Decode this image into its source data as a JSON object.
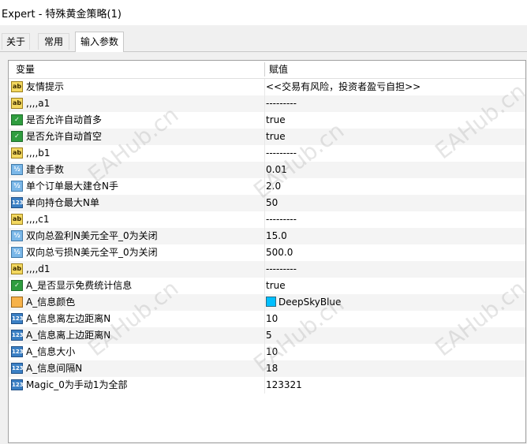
{
  "window": {
    "title": "Expert - 特殊黄金策略(1)"
  },
  "tabs": [
    {
      "label": "关于"
    },
    {
      "label": "常用"
    },
    {
      "label": "输入参数"
    }
  ],
  "grid": {
    "headers": {
      "variable": "变量",
      "value": "赋值"
    },
    "rows": [
      {
        "icon": "ab",
        "name": "友情提示",
        "value": "<<交易有风险，投资者盈亏自担>>"
      },
      {
        "icon": "ab",
        "name": ",,,,a1",
        "value": "---------"
      },
      {
        "icon": "bool",
        "name": "是否允许自动首多",
        "value": "true"
      },
      {
        "icon": "bool",
        "name": "是否允许自动首空",
        "value": "true"
      },
      {
        "icon": "ab",
        "name": ",,,,b1",
        "value": "---------"
      },
      {
        "icon": "dbl",
        "name": "建仓手数",
        "value": "0.01"
      },
      {
        "icon": "dbl",
        "name": "单个订单最大建仓N手",
        "value": "2.0"
      },
      {
        "icon": "int",
        "name": "单向持仓最大N单",
        "value": "50"
      },
      {
        "icon": "ab",
        "name": ",,,,c1",
        "value": "---------"
      },
      {
        "icon": "dbl",
        "name": "双向总盈利N美元全平_0为关闭",
        "value": "15.0"
      },
      {
        "icon": "dbl",
        "name": "双向总亏损N美元全平_0为关闭",
        "value": "500.0"
      },
      {
        "icon": "ab",
        "name": ",,,,d1",
        "value": "---------"
      },
      {
        "icon": "bool",
        "name": "A_是否显示免费统计信息",
        "value": "true"
      },
      {
        "icon": "color",
        "name": "A_信息颜色",
        "value": "DeepSkyBlue",
        "swatch": "#00bfff"
      },
      {
        "icon": "int",
        "name": "A_信息离左边距离N",
        "value": "10"
      },
      {
        "icon": "int",
        "name": "A_信息离上边距离N",
        "value": "5"
      },
      {
        "icon": "int",
        "name": "A_信息大小",
        "value": "10"
      },
      {
        "icon": "int",
        "name": "A_信息间隔N",
        "value": "18"
      },
      {
        "icon": "int",
        "name": "Magic_0为手动1为全部",
        "value": "123321"
      }
    ]
  },
  "icon_glyphs": {
    "ab": "ab",
    "bool": "✓",
    "dbl": "½",
    "int": "123",
    "color": ""
  },
  "watermark": "EAHub.cn"
}
